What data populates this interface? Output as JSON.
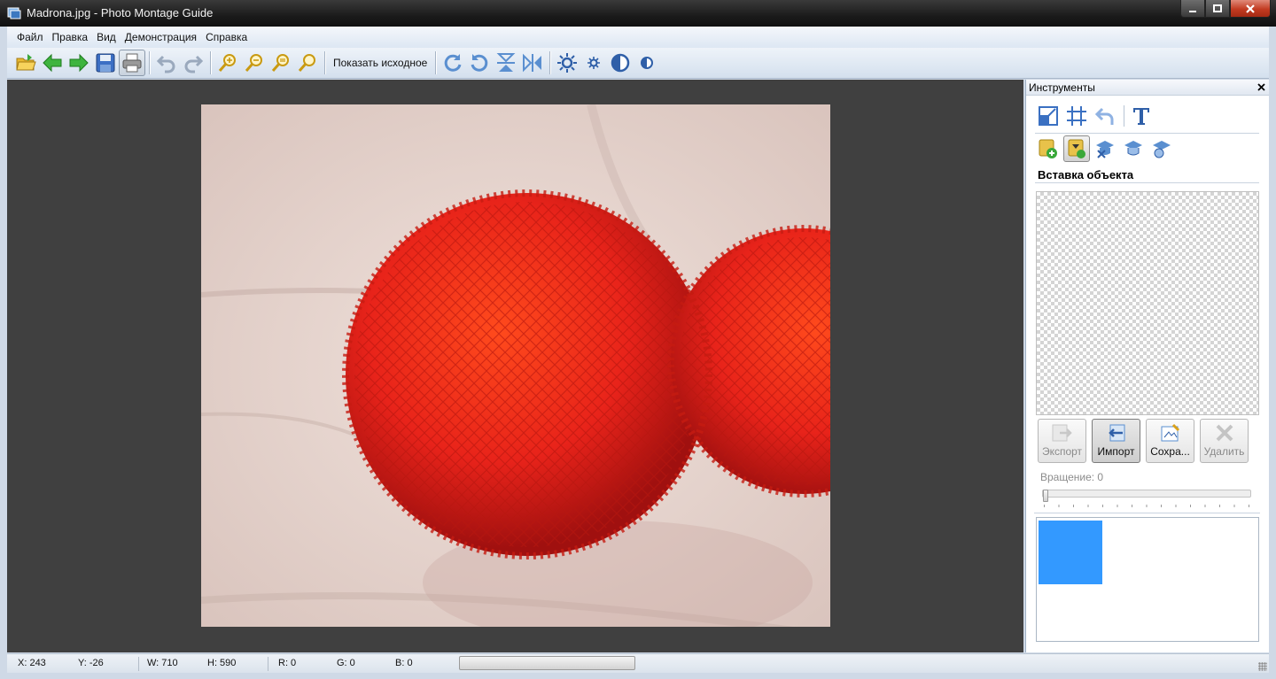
{
  "window": {
    "title": "Madrona.jpg - Photo Montage Guide",
    "controls": [
      "minimize",
      "maximize",
      "close"
    ]
  },
  "menu": [
    "Файл",
    "Правка",
    "Вид",
    "Демонстрация",
    "Справка"
  ],
  "toolbar": {
    "show_original_label": "Показать исходное",
    "icons": [
      "open-folder-icon",
      "back-arrow-icon",
      "forward-arrow-icon",
      "save-icon",
      "print-icon",
      "undo-icon",
      "redo-icon",
      "zoom-in-icon",
      "zoom-out-icon",
      "zoom-fit-icon",
      "zoom-actual-icon",
      "rotate-cw-icon",
      "rotate-ccw-icon",
      "flip-vertical-icon",
      "flip-horizontal-icon",
      "brightness-up-icon",
      "brightness-down-icon",
      "contrast-up-icon",
      "contrast-down-icon"
    ]
  },
  "panel": {
    "title": "Инструменты",
    "close_glyph": "✕",
    "section_title": "Вставка объекта",
    "buttons": {
      "export": "Экспорт",
      "import": "Импорт",
      "save": "Сохра...",
      "delete": "Удалить"
    },
    "rotation_label": "Вращение: 0",
    "rotation_value": 0
  },
  "status": {
    "x": "X: 243",
    "y": "Y: -26",
    "w": "W: 710",
    "h": "H: 590",
    "r": "R: 0",
    "g": "G: 0",
    "b": "B: 0"
  },
  "colors": {
    "canvas_bg": "#404040",
    "thumbnail": "#3399ff",
    "berry": "#e8231a"
  }
}
